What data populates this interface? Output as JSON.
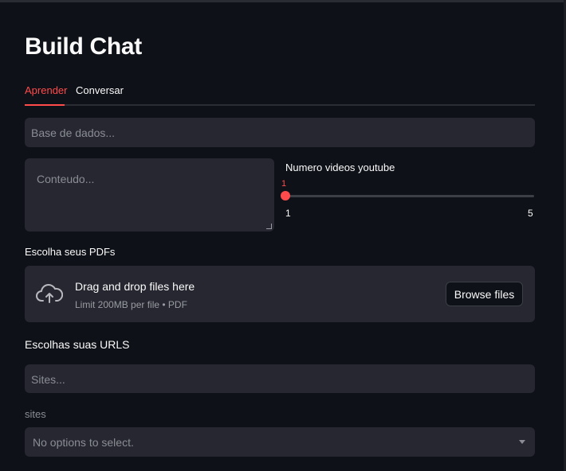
{
  "page": {
    "title": "Build Chat"
  },
  "tabs": [
    {
      "label": "Aprender",
      "active": true
    },
    {
      "label": "Conversar",
      "active": false
    }
  ],
  "aprender": {
    "database_input": {
      "placeholder": "Base de dados..."
    },
    "content_textarea": {
      "placeholder": "Conteudo..."
    },
    "youtube_slider": {
      "label": "Numero videos youtube",
      "value": "1",
      "min": "1",
      "max": "5"
    },
    "pdf_uploader": {
      "label": "Escolha seus PDFs",
      "drop_text": "Drag and drop files here",
      "limit_text": "Limit 200MB per file • PDF",
      "browse_label": "Browse files"
    },
    "urls_section": {
      "label": "Escolhas suas URLS"
    },
    "sites_input": {
      "placeholder": "Sites..."
    },
    "sites_select": {
      "label": "sites",
      "placeholder": "No options to select."
    }
  },
  "colors": {
    "accent": "#ff4b4b",
    "background": "#0e1117",
    "input_bg": "#262730"
  },
  "icons": {
    "upload": "cloud-upload-icon",
    "dropdown": "chevron-down-icon"
  }
}
